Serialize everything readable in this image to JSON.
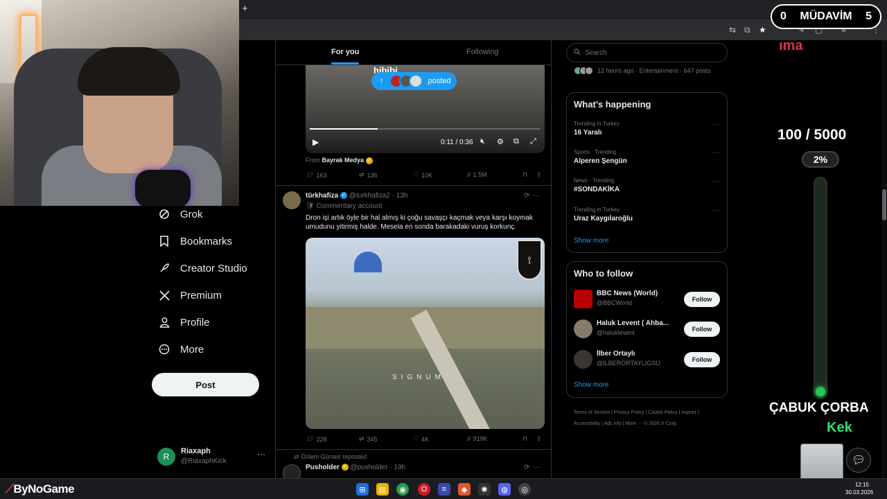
{
  "counter": {
    "left": "0",
    "label": "MÜDAVİM",
    "right": "5"
  },
  "browser": {
    "new_tab": "+"
  },
  "nav": {
    "items": [
      {
        "label": "Grok",
        "icon": "grok-icon"
      },
      {
        "label": "Bookmarks",
        "icon": "bookmark-icon"
      },
      {
        "label": "Creator Studio",
        "icon": "rocket-icon"
      },
      {
        "label": "Premium",
        "icon": "x-logo-icon"
      },
      {
        "label": "Profile",
        "icon": "person-icon"
      },
      {
        "label": "More",
        "icon": "more-circle-icon"
      }
    ],
    "post_label": "Post",
    "account": {
      "initial": "R",
      "name": "Riaxaph",
      "handle": "@RiaxaphKick",
      "menu": "···"
    }
  },
  "feed": {
    "tabs": {
      "for_you": "For you",
      "following": "Following"
    },
    "posted_pill": {
      "label": "posted"
    },
    "video1": {
      "caption": "hibibi",
      "time": "0:11 / 0:36"
    },
    "tweet1": {
      "from_prefix": "From",
      "from_name": "Bayrak Medya",
      "replies": "163",
      "reposts": "136",
      "likes": "10K",
      "views": "1.5M"
    },
    "tweet2": {
      "name": "türkhafiza",
      "handle": "@turkhafiza2",
      "time": "· 13h",
      "label": "Commentary account",
      "text": "Dron işi artık öyle bir hal almış ki çoğu savaşçı kaçmak veya karşı koymak umudunu yitirmiş halde. Mesela en sonda barakadaki vuruş korkunç.",
      "watermark": "SIGNUM",
      "replies": "228",
      "reposts": "345",
      "likes": "4K",
      "views": "919K"
    },
    "tweet3": {
      "repost_line": "Özlem Gürses reposted",
      "name": "Pusholder",
      "handle": "@pusholder",
      "time": "· 19h"
    }
  },
  "right": {
    "search_placeholder": "Search",
    "trend_top_meta": "12 hours ago · Entertainment · 647 posts",
    "happening_title": "What’s happening",
    "trends": [
      {
        "cat": "Trending in Turkey",
        "name": "16 Yaralı"
      },
      {
        "cat": "Sports · Trending",
        "name": "Alperen Şengün"
      },
      {
        "cat": "News · Trending",
        "name": "#SONDAKİKA"
      },
      {
        "cat": "Trending in Turkey",
        "name": "Uraz Kaygılaroğlu"
      }
    ],
    "show_more": "Show more",
    "who_title": "Who to follow",
    "follows": [
      {
        "name": "BBC News (World)",
        "handle": "@BBCWorld",
        "btn": "Follow"
      },
      {
        "name": "Haluk Levent ( Ahba...",
        "handle": "@haluklevent",
        "btn": "Follow"
      },
      {
        "name": "İlber Ortaylı",
        "handle": "@ILBERORTAYLIGSU",
        "btn": "Follow"
      }
    ],
    "footer": "Terms of Service  |  Privacy Policy  |  Cookie Policy  |  Imprint  |  Accessibility  |  Ads info  |  More ···  © 2026 X Corp."
  },
  "stream": {
    "top_text": "ıma",
    "goal": "100 / 5000",
    "goal_progress": 0.02,
    "percent": "2%",
    "corba": "ÇABUK ÇORBA",
    "kek": "Kek"
  },
  "taskbar": {
    "brand_a": "ByNo",
    "brand_b": "Game",
    "time": "12:15",
    "date": "30.03.2026"
  },
  "colors": {
    "accent": "#1d9bf0",
    "bg": "#000000",
    "goal_green": "#27c45a",
    "brand_red": "#e0304e"
  }
}
